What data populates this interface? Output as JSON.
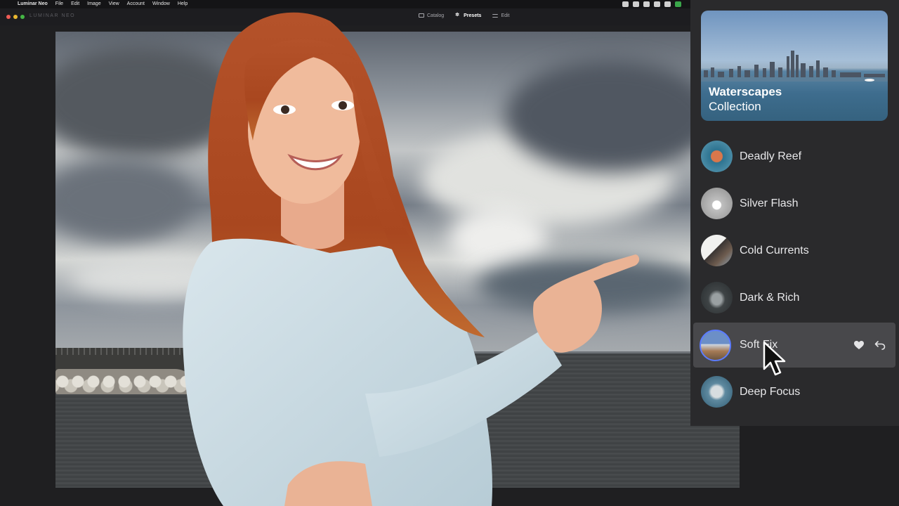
{
  "menubar": {
    "apple_icon": "apple-icon",
    "items": [
      "Luminar Neo",
      "File",
      "Edit",
      "Image",
      "View",
      "Account",
      "Window",
      "Help"
    ]
  },
  "toolbar": {
    "logo": "LUMINAR NEO",
    "nav": [
      {
        "label": "Catalog",
        "icon": "catalog-icon"
      },
      {
        "label": "Presets",
        "icon": "presets-icon",
        "active": true
      },
      {
        "label": "Edit",
        "icon": "edit-icon"
      }
    ]
  },
  "collection": {
    "title": "Waterscapes",
    "subtitle": "Collection"
  },
  "presets": [
    {
      "label": "Deadly Reef"
    },
    {
      "label": "Silver Flash"
    },
    {
      "label": "Cold Currents"
    },
    {
      "label": "Dark & Rich"
    },
    {
      "label": "Soft Fix",
      "selected": true
    },
    {
      "label": "Deep Focus"
    }
  ],
  "colors": {
    "accent": "#5c7cff",
    "panel": "#2a2a2c",
    "selected_row": "#48484b"
  }
}
